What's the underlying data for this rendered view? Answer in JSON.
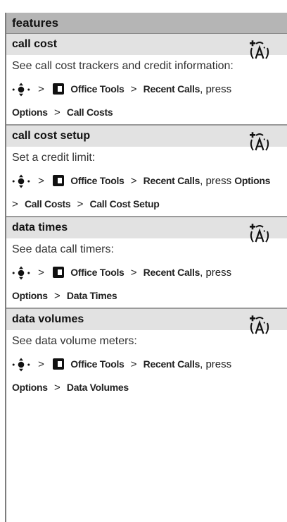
{
  "header": {
    "title": "features"
  },
  "sections": [
    {
      "title": "call cost",
      "description": "See call cost trackers and credit information:",
      "path": {
        "menu": "Office Tools",
        "submenu": "Recent Calls",
        "press": "press",
        "options": "Options",
        "target": "Call Costs"
      }
    },
    {
      "title": "call cost setup",
      "description": "Set a credit limit:",
      "path": {
        "menu": "Office Tools",
        "submenu": "Recent Calls",
        "press": "press",
        "options": "Options",
        "target": "Call Costs",
        "target2": "Call Cost Setup"
      }
    },
    {
      "title": "data times",
      "description": "See data call timers:",
      "path": {
        "menu": "Office Tools",
        "submenu": "Recent Calls",
        "press": "press",
        "options": "Options",
        "target": "Data Times"
      }
    },
    {
      "title": "data volumes",
      "description": "See data volume meters:",
      "path": {
        "menu": "Office Tools",
        "submenu": "Recent Calls",
        "press": "press",
        "options": "Options",
        "target": "Data Volumes"
      }
    }
  ],
  "separator": ">",
  "icons": {
    "network": "network-feature-icon",
    "nav": "navigation-key-icon",
    "menu": "menu-key-icon"
  }
}
